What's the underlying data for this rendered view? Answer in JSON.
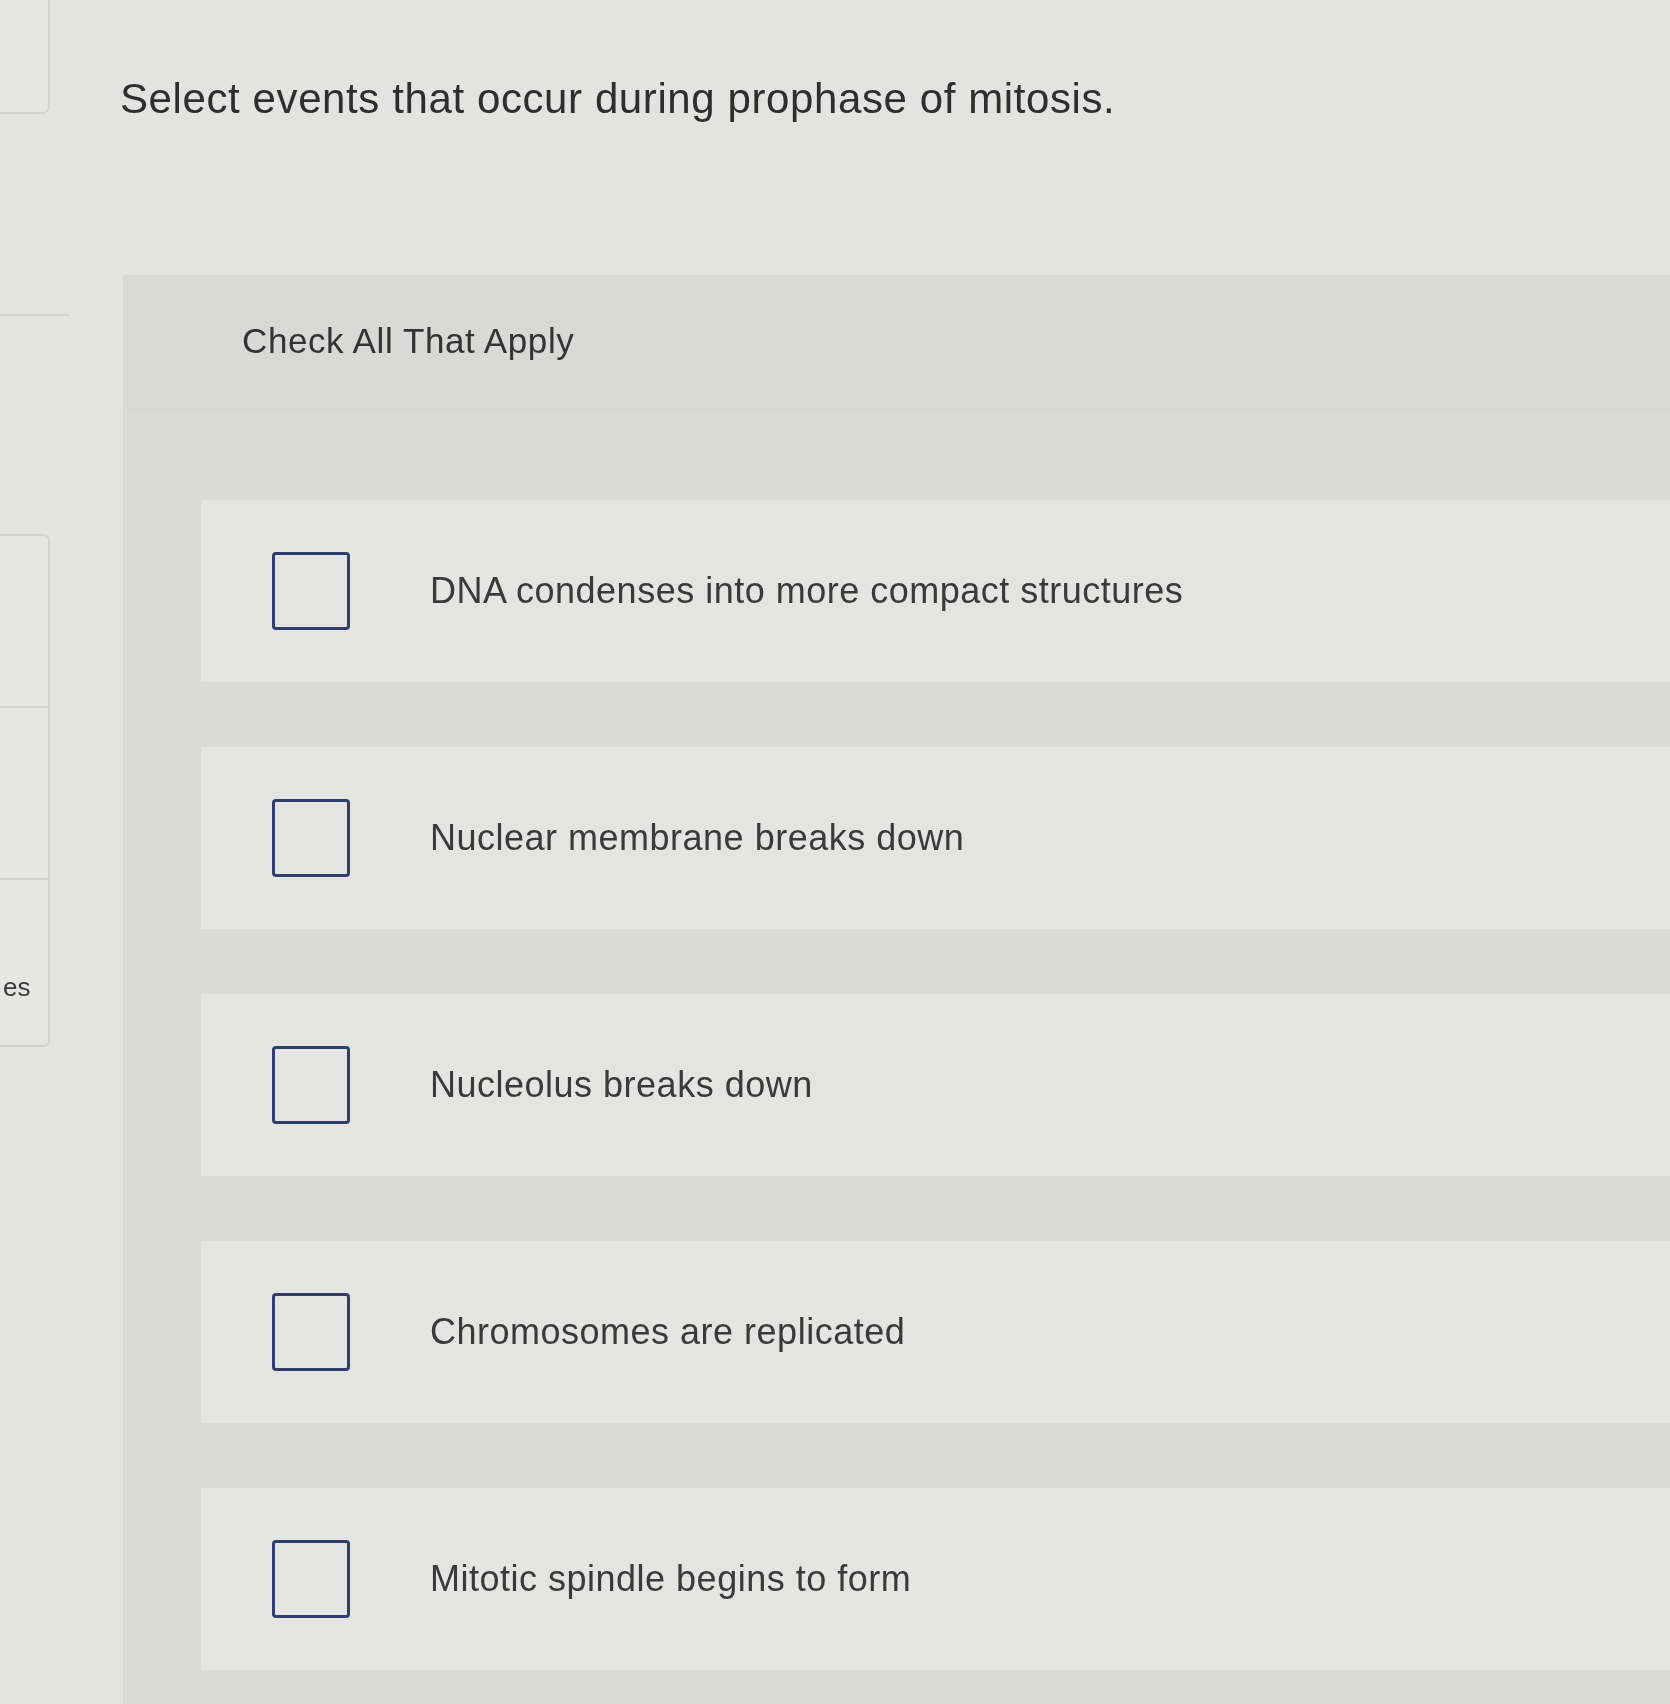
{
  "sidebar": {
    "label": "es"
  },
  "question": {
    "text": "Select events that occur during prophase of mitosis."
  },
  "instructions": "Check All That Apply",
  "options": [
    {
      "label": "DNA condenses into more compact structures",
      "checked": false
    },
    {
      "label": "Nuclear membrane breaks down",
      "checked": false
    },
    {
      "label": "Nucleolus breaks down",
      "checked": false
    },
    {
      "label": "Chromosomes are replicated",
      "checked": false
    },
    {
      "label": "Mitotic spindle begins to form",
      "checked": false
    }
  ]
}
